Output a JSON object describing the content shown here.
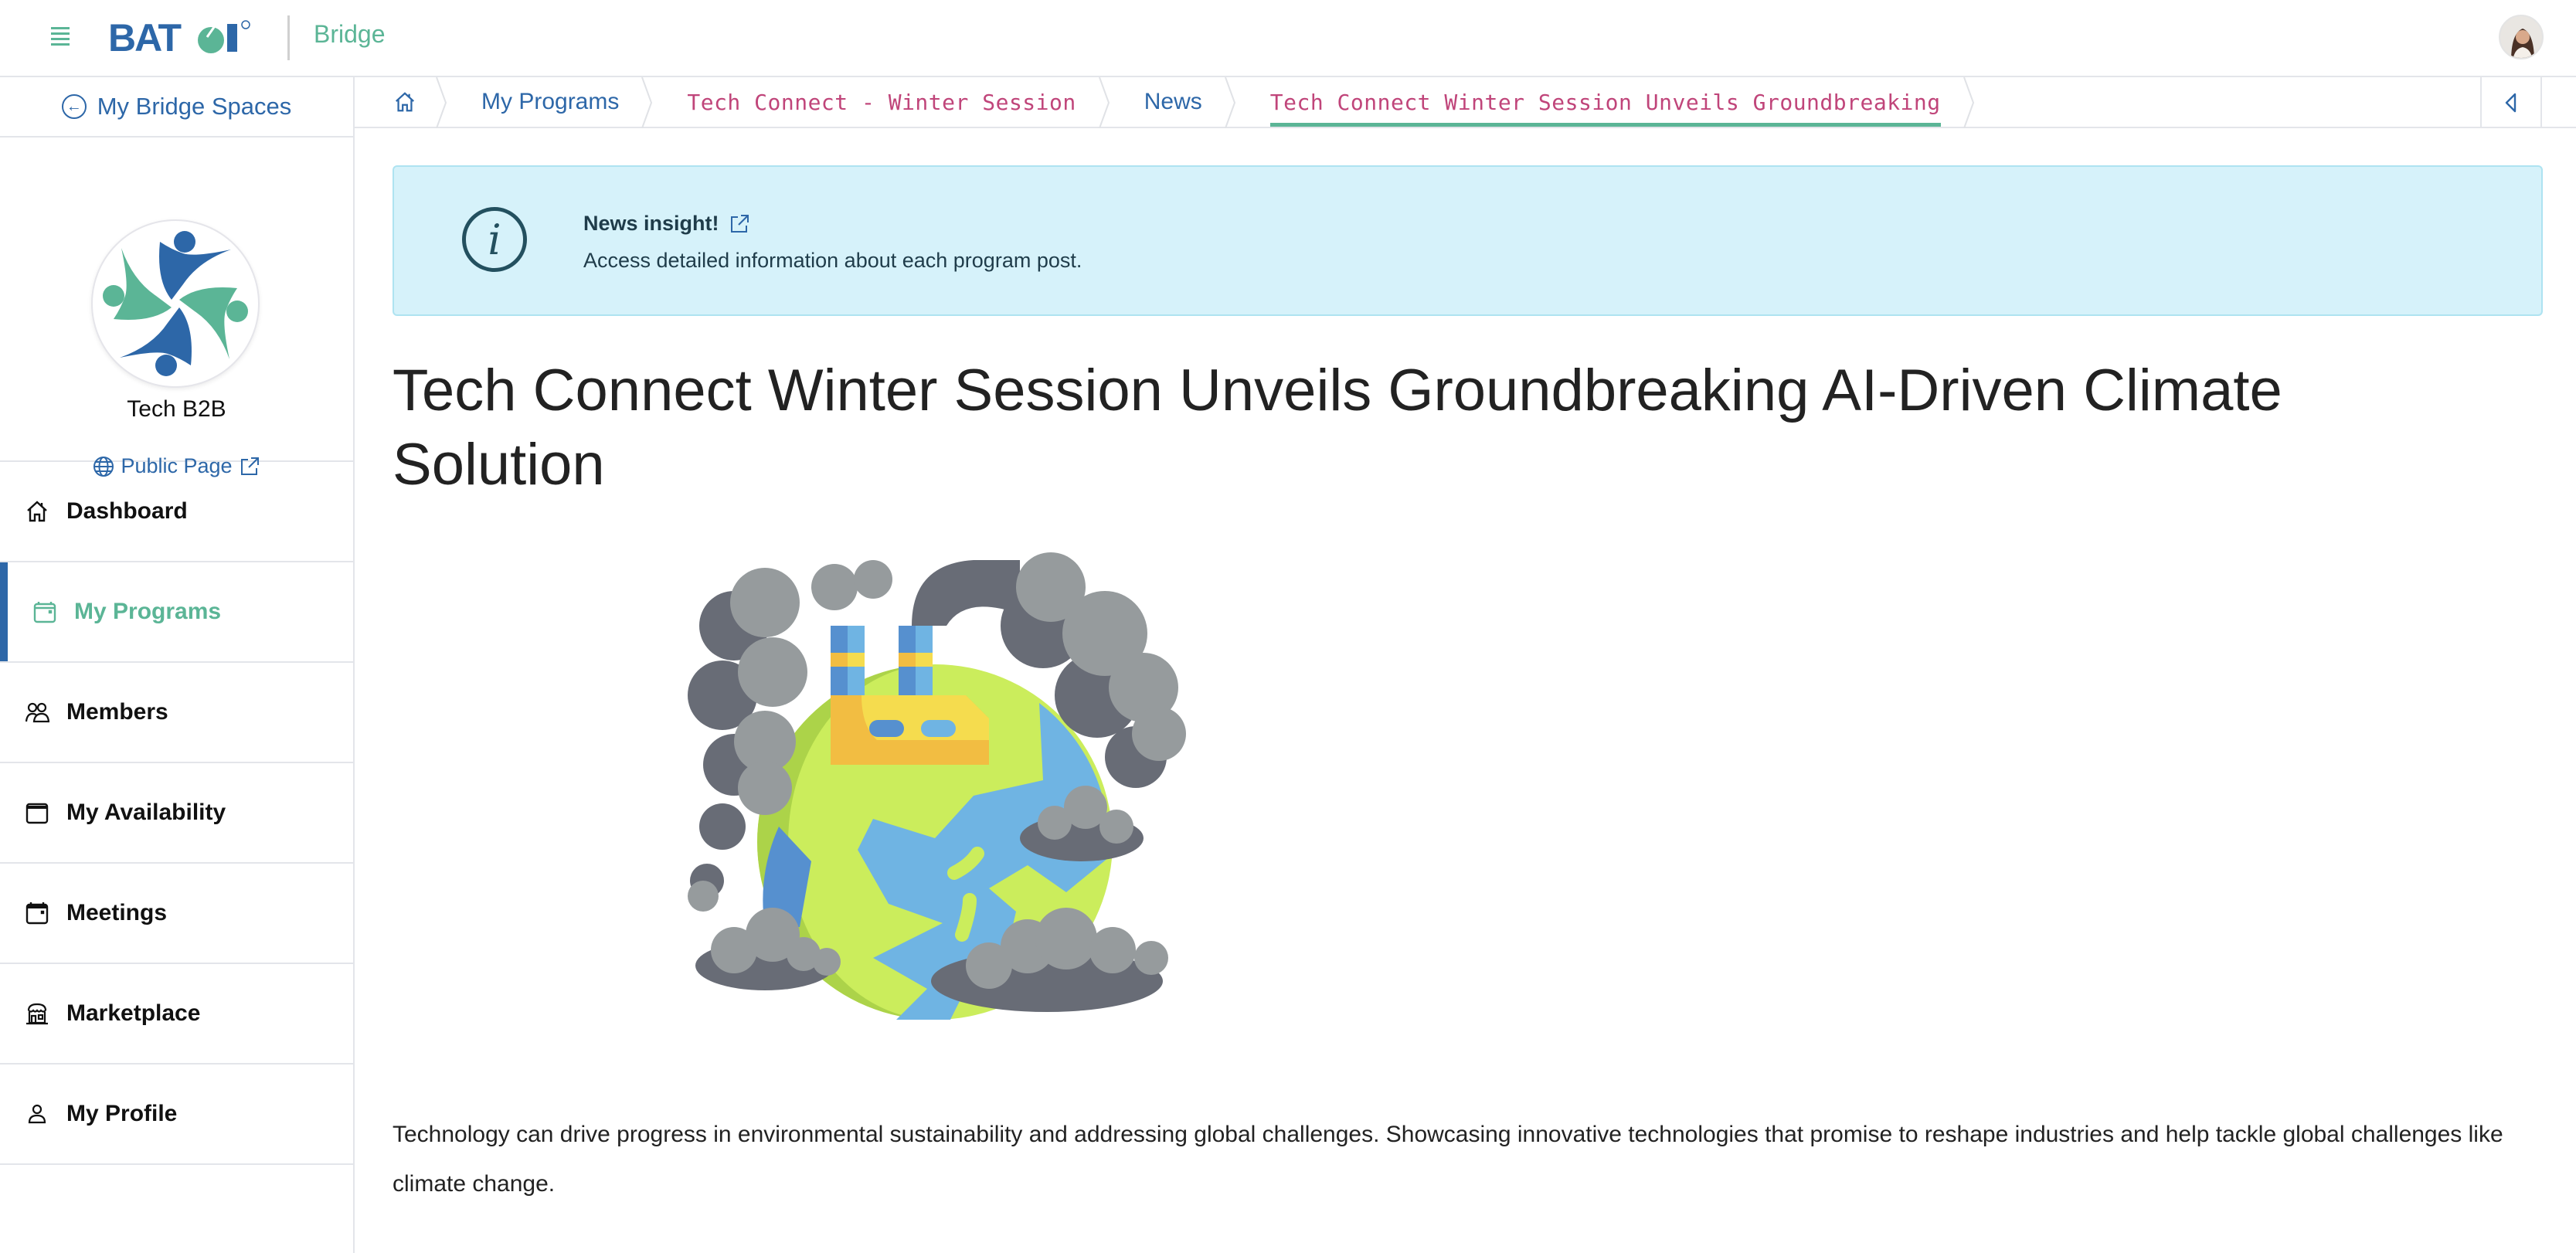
{
  "header": {
    "brand_logo_text": "BATOI",
    "brand_name": "Bridge",
    "menu_icon": "hamburger-icon",
    "avatar_alt": "User avatar"
  },
  "sidebar": {
    "back_link": "My Bridge Spaces",
    "org_name": "Tech B2B",
    "public_page": "Public Page",
    "items": [
      {
        "label": "Dashboard",
        "icon": "home-icon",
        "active": false
      },
      {
        "label": "My Programs",
        "icon": "calendar-icon",
        "active": true
      },
      {
        "label": "Members",
        "icon": "members-icon",
        "active": false
      },
      {
        "label": "My Availability",
        "icon": "calendar-blank-icon",
        "active": false
      },
      {
        "label": "Meetings",
        "icon": "calendar-icon",
        "active": false
      },
      {
        "label": "Marketplace",
        "icon": "store-icon",
        "active": false
      },
      {
        "label": "My Profile",
        "icon": "user-icon",
        "active": false
      }
    ]
  },
  "breadcrumb": [
    {
      "label": "",
      "icon": "home-icon"
    },
    {
      "label": "My Programs"
    },
    {
      "label": "Tech Connect - Winter Session"
    },
    {
      "label": "News"
    },
    {
      "label": "Tech Connect Winter Session Unveils Groundbreaking",
      "current": true
    }
  ],
  "info": {
    "title": "News insight!",
    "text": "Access detailed information about each program post."
  },
  "article": {
    "title": "Tech Connect Winter Session Unveils Groundbreaking AI-Driven Climate Solution",
    "image_alt": "Illustration of polluted earth with factory and smoke clouds",
    "body": "Technology can drive progress in environmental sustainability and addressing global challenges. Showcasing innovative technologies that promise to reshape industries and help tackle global challenges like climate change."
  },
  "colors": {
    "primary_blue": "#2d67a8",
    "accent_green": "#5bb596",
    "crumb_magenta": "#c0457a",
    "info_bg": "#d6f2fa"
  }
}
